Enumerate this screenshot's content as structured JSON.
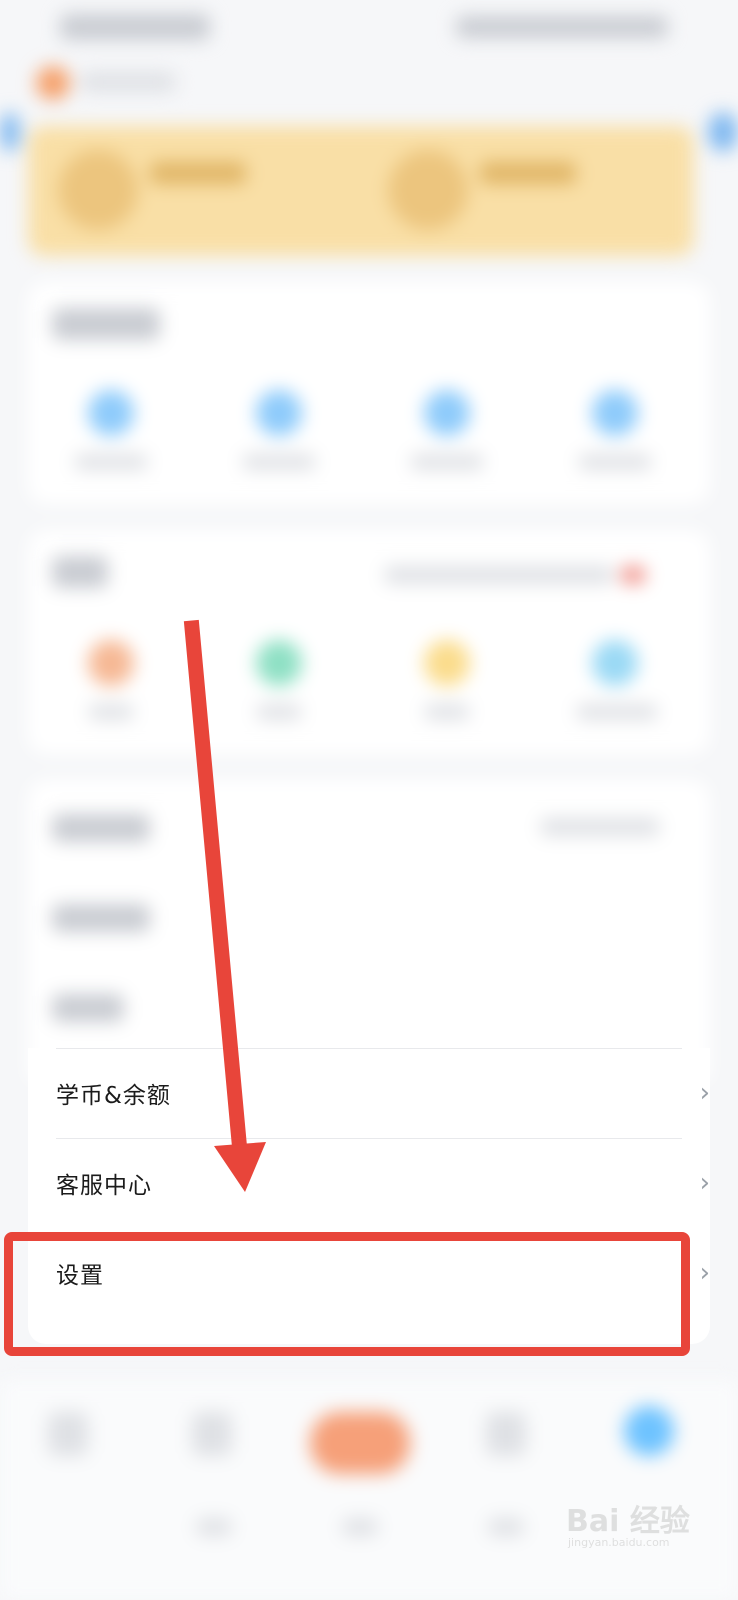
{
  "menu": {
    "items": [
      {
        "label": "学币&余额",
        "chevron": "›"
      },
      {
        "label": "客服中心",
        "chevron": "›"
      },
      {
        "label": "设置",
        "chevron": "›"
      }
    ]
  },
  "watermark": {
    "brand": "Bai 经验",
    "site": "jingyan.baidu.com"
  },
  "colors": {
    "annotation": "#e8453a",
    "banner": "#f9dfa6",
    "accent_blue": "#6ec3ff"
  }
}
